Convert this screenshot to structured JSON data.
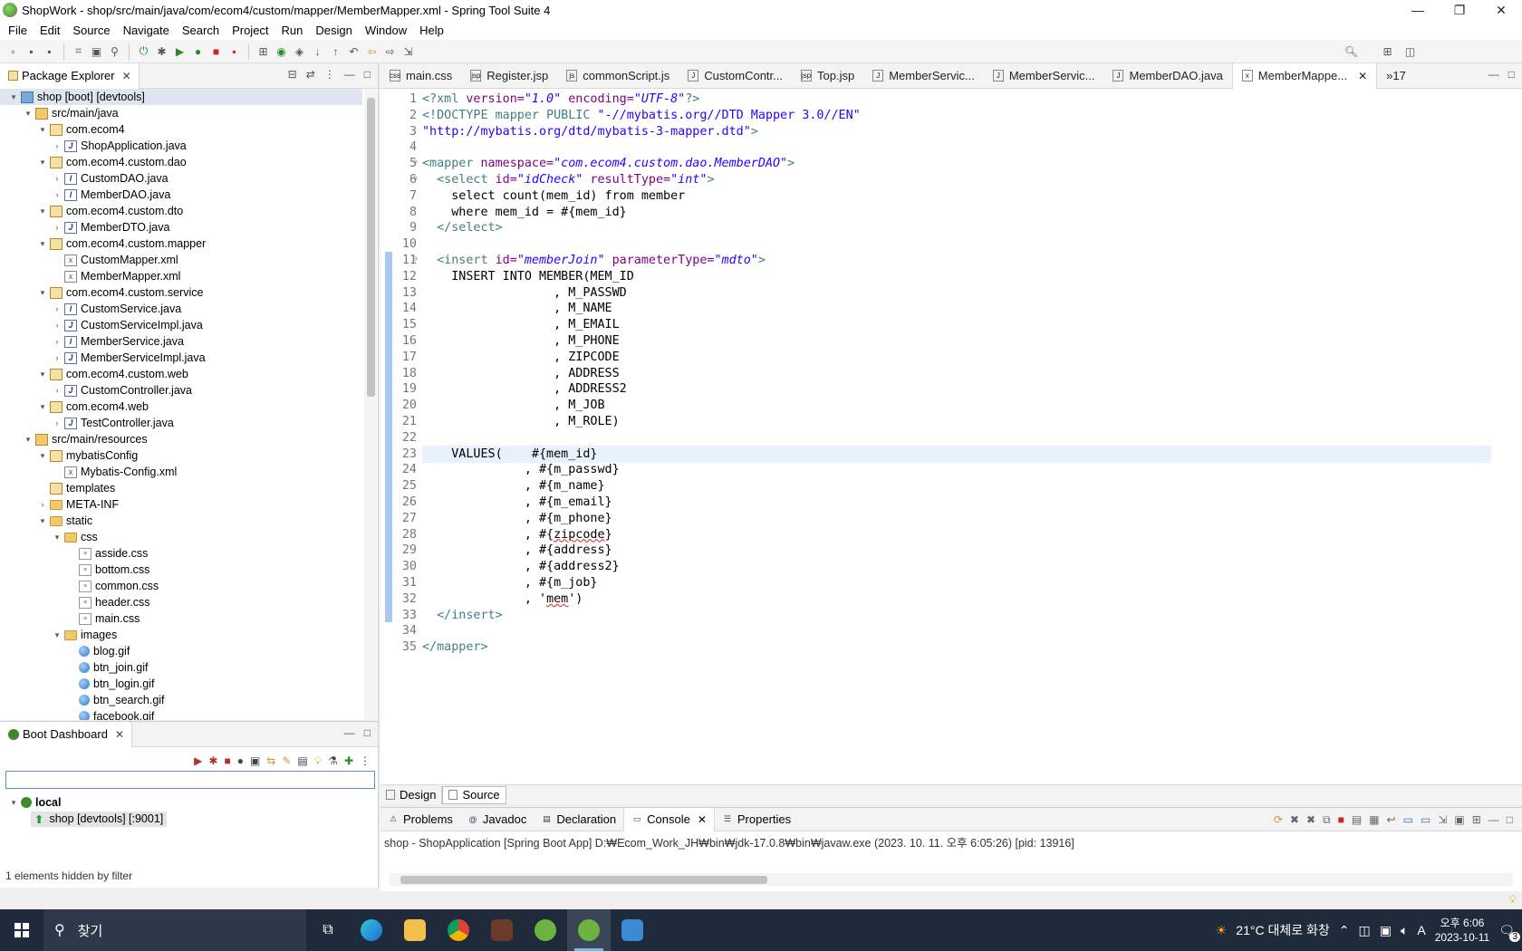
{
  "window": {
    "title": "ShopWork - shop/src/main/java/com/ecom4/custom/mapper/MemberMapper.xml - Spring Tool Suite 4",
    "controls": {
      "minimize": "—",
      "restore": "❐",
      "close": "✕"
    }
  },
  "menu": [
    "File",
    "Edit",
    "Source",
    "Navigate",
    "Search",
    "Project",
    "Run",
    "Design",
    "Window",
    "Help"
  ],
  "package_explorer": {
    "title": "Package Explorer",
    "tree": [
      {
        "label": "shop [boot] [devtools]",
        "depth": 0,
        "icon": "project-icon",
        "expander": "▾",
        "selected": true
      },
      {
        "label": "src/main/java",
        "depth": 1,
        "icon": "source-folder-icon",
        "expander": "▾"
      },
      {
        "label": "com.ecom4",
        "depth": 2,
        "icon": "package-icon",
        "expander": "▾"
      },
      {
        "label": "ShopApplication.java",
        "depth": 3,
        "icon": "java-file-icon",
        "expander": "›"
      },
      {
        "label": "com.ecom4.custom.dao",
        "depth": 2,
        "icon": "package-icon",
        "expander": "▾"
      },
      {
        "label": "CustomDAO.java",
        "depth": 3,
        "icon": "java-interface-icon",
        "expander": "›"
      },
      {
        "label": "MemberDAO.java",
        "depth": 3,
        "icon": "java-interface-icon",
        "expander": "›"
      },
      {
        "label": "com.ecom4.custom.dto",
        "depth": 2,
        "icon": "package-icon",
        "expander": "▾"
      },
      {
        "label": "MemberDTO.java",
        "depth": 3,
        "icon": "java-file-icon",
        "expander": "›"
      },
      {
        "label": "com.ecom4.custom.mapper",
        "depth": 2,
        "icon": "package-icon",
        "expander": "▾"
      },
      {
        "label": "CustomMapper.xml",
        "depth": 3,
        "icon": "xml-file-icon",
        "expander": ""
      },
      {
        "label": "MemberMapper.xml",
        "depth": 3,
        "icon": "xml-file-icon",
        "expander": ""
      },
      {
        "label": "com.ecom4.custom.service",
        "depth": 2,
        "icon": "package-icon",
        "expander": "▾"
      },
      {
        "label": "CustomService.java",
        "depth": 3,
        "icon": "java-interface-icon",
        "expander": "›"
      },
      {
        "label": "CustomServiceImpl.java",
        "depth": 3,
        "icon": "java-file-icon",
        "expander": "›"
      },
      {
        "label": "MemberService.java",
        "depth": 3,
        "icon": "java-interface-icon",
        "expander": "›"
      },
      {
        "label": "MemberServiceImpl.java",
        "depth": 3,
        "icon": "java-file-icon",
        "expander": "›"
      },
      {
        "label": "com.ecom4.custom.web",
        "depth": 2,
        "icon": "package-icon",
        "expander": "▾"
      },
      {
        "label": "CustomController.java",
        "depth": 3,
        "icon": "java-file-icon",
        "expander": "›"
      },
      {
        "label": "com.ecom4.web",
        "depth": 2,
        "icon": "package-icon",
        "expander": "▾"
      },
      {
        "label": "TestController.java",
        "depth": 3,
        "icon": "java-file-icon",
        "expander": "›"
      },
      {
        "label": "src/main/resources",
        "depth": 1,
        "icon": "source-folder-icon",
        "expander": "▾"
      },
      {
        "label": "mybatisConfig",
        "depth": 2,
        "icon": "package-icon",
        "expander": "▾"
      },
      {
        "label": "Mybatis-Config.xml",
        "depth": 3,
        "icon": "xml-file-icon",
        "expander": ""
      },
      {
        "label": "templates",
        "depth": 2,
        "icon": "package-icon",
        "expander": ""
      },
      {
        "label": "META-INF",
        "depth": 2,
        "icon": "folder-icon",
        "expander": "›"
      },
      {
        "label": "static",
        "depth": 2,
        "icon": "folder-icon",
        "expander": "▾"
      },
      {
        "label": "css",
        "depth": 3,
        "icon": "folder-icon",
        "expander": "▾"
      },
      {
        "label": "asside.css",
        "depth": 4,
        "icon": "css-file-icon",
        "expander": ""
      },
      {
        "label": "bottom.css",
        "depth": 4,
        "icon": "css-file-icon",
        "expander": ""
      },
      {
        "label": "common.css",
        "depth": 4,
        "icon": "css-file-icon",
        "expander": ""
      },
      {
        "label": "header.css",
        "depth": 4,
        "icon": "css-file-icon",
        "expander": ""
      },
      {
        "label": "main.css",
        "depth": 4,
        "icon": "css-file-icon",
        "expander": ""
      },
      {
        "label": "images",
        "depth": 3,
        "icon": "folder-icon",
        "expander": "▾"
      },
      {
        "label": "blog.gif",
        "depth": 4,
        "icon": "image-file-icon",
        "expander": ""
      },
      {
        "label": "btn_join.gif",
        "depth": 4,
        "icon": "image-file-icon",
        "expander": ""
      },
      {
        "label": "btn_login.gif",
        "depth": 4,
        "icon": "image-file-icon",
        "expander": ""
      },
      {
        "label": "btn_search.gif",
        "depth": 4,
        "icon": "image-file-icon",
        "expander": ""
      },
      {
        "label": "facebook.gif",
        "depth": 4,
        "icon": "image-file-icon",
        "expander": ""
      }
    ]
  },
  "boot_dashboard": {
    "title": "Boot Dashboard",
    "filter_value": "",
    "group": "local",
    "app": "shop [devtools] [:9001]",
    "status": "1 elements hidden by filter"
  },
  "editor": {
    "tabs": [
      {
        "label": "main.css",
        "icon": "css"
      },
      {
        "label": "Register.jsp",
        "icon": "jsp"
      },
      {
        "label": "commonScript.js",
        "icon": "js"
      },
      {
        "label": "CustomContr...",
        "icon": "J"
      },
      {
        "label": "Top.jsp",
        "icon": "jsp"
      },
      {
        "label": "MemberServic...",
        "icon": "J"
      },
      {
        "label": "MemberServic...",
        "icon": "J"
      },
      {
        "label": "MemberDAO.java",
        "icon": "J"
      },
      {
        "label": "MemberMappe...",
        "icon": "x",
        "active": true
      }
    ],
    "overflow": "»17",
    "current_line": 23,
    "changed_range": [
      11,
      33
    ],
    "lines": [
      [
        {
          "t": "<?xml ",
          "c": "t-pi"
        },
        {
          "t": "version=",
          "c": "t-attr"
        },
        {
          "t": "\"1.0\"",
          "c": "t-val"
        },
        {
          "t": " encoding=",
          "c": "t-attr"
        },
        {
          "t": "\"UTF-8\"",
          "c": "t-val"
        },
        {
          "t": "?>",
          "c": "t-pi"
        }
      ],
      [
        {
          "t": "<!DOCTYPE mapper PUBLIC ",
          "c": "t-doctype"
        },
        {
          "t": "\"-//mybatis.org//DTD Mapper 3.0//EN\"",
          "c": "t-str"
        }
      ],
      [
        {
          "t": "\"http://mybatis.org/dtd/mybatis-3-mapper.dtd\"",
          "c": "t-str"
        },
        {
          "t": ">",
          "c": "t-doctype"
        }
      ],
      [],
      [
        {
          "t": "<mapper ",
          "c": "t-tag"
        },
        {
          "t": "namespace=",
          "c": "t-attr"
        },
        {
          "t": "\"com.ecom4.custom.dao.MemberDAO\"",
          "c": "t-val"
        },
        {
          "t": ">",
          "c": "t-tag"
        }
      ],
      [
        {
          "t": "  <select ",
          "c": "t-tag"
        },
        {
          "t": "id=",
          "c": "t-attr"
        },
        {
          "t": "\"idCheck\"",
          "c": "t-val"
        },
        {
          "t": " resultType=",
          "c": "t-attr"
        },
        {
          "t": "\"int\"",
          "c": "t-val"
        },
        {
          "t": ">",
          "c": "t-tag"
        }
      ],
      [
        {
          "t": "    select count(mem_id) from member",
          "c": "t-text"
        }
      ],
      [
        {
          "t": "    where mem_id = #{mem_id}",
          "c": "t-text"
        }
      ],
      [
        {
          "t": "  </select>",
          "c": "t-tag"
        }
      ],
      [],
      [
        {
          "t": "  <insert ",
          "c": "t-tag"
        },
        {
          "t": "id=",
          "c": "t-attr"
        },
        {
          "t": "\"memberJoin\"",
          "c": "t-val"
        },
        {
          "t": " parameterType=",
          "c": "t-attr"
        },
        {
          "t": "\"mdto\"",
          "c": "t-val"
        },
        {
          "t": ">",
          "c": "t-tag"
        }
      ],
      [
        {
          "t": "    INSERT INTO MEMBER(MEM_ID",
          "c": "t-text"
        }
      ],
      [
        {
          "t": "                  , M_PASSWD",
          "c": "t-text"
        }
      ],
      [
        {
          "t": "                  , M_NAME",
          "c": "t-text"
        }
      ],
      [
        {
          "t": "                  , M_EMAIL",
          "c": "t-text"
        }
      ],
      [
        {
          "t": "                  , M_PHONE",
          "c": "t-text"
        }
      ],
      [
        {
          "t": "                  , ZIPCODE",
          "c": "t-text"
        }
      ],
      [
        {
          "t": "                  , ADDRESS",
          "c": "t-text"
        }
      ],
      [
        {
          "t": "                  , ADDRESS2",
          "c": "t-text"
        }
      ],
      [
        {
          "t": "                  , M_JOB",
          "c": "t-text"
        }
      ],
      [
        {
          "t": "                  , M_ROLE)",
          "c": "t-text"
        }
      ],
      [],
      [
        {
          "t": "    VALUES(    #{mem_id}",
          "c": "t-text"
        }
      ],
      [
        {
          "t": "              , #{m_passwd}",
          "c": "t-text"
        }
      ],
      [
        {
          "t": "              , #{m_name}",
          "c": "t-text"
        }
      ],
      [
        {
          "t": "              , #{m_email}",
          "c": "t-text"
        }
      ],
      [
        {
          "t": "              , #{m_phone}",
          "c": "t-text"
        }
      ],
      [
        {
          "t": "              , #{",
          "c": "t-text"
        },
        {
          "t": "zipcode",
          "c": "t-text squig"
        },
        {
          "t": "}",
          "c": "t-text"
        }
      ],
      [
        {
          "t": "              , #{address}",
          "c": "t-text"
        }
      ],
      [
        {
          "t": "              , #{address2}",
          "c": "t-text"
        }
      ],
      [
        {
          "t": "              , #{m_job}",
          "c": "t-text"
        }
      ],
      [
        {
          "t": "              , '",
          "c": "t-text"
        },
        {
          "t": "mem",
          "c": "t-text squig"
        },
        {
          "t": "')",
          "c": "t-text"
        }
      ],
      [
        {
          "t": "  </insert>",
          "c": "t-tag"
        }
      ],
      [],
      [
        {
          "t": "</mapper>",
          "c": "t-tag"
        }
      ]
    ],
    "fold_lines": [
      5,
      6,
      11
    ],
    "bottom_tabs": [
      {
        "label": "Design"
      },
      {
        "label": "Source",
        "active": true
      }
    ]
  },
  "console": {
    "tabs": [
      {
        "label": "Problems",
        "icon": "⚠"
      },
      {
        "label": "Javadoc",
        "icon": "@"
      },
      {
        "label": "Declaration",
        "icon": "▤"
      },
      {
        "label": "Console",
        "icon": "▭",
        "active": true,
        "closable": true
      },
      {
        "label": "Properties",
        "icon": "☰"
      }
    ],
    "text": "shop - ShopApplication [Spring Boot App] D:₩Ecom_Work_JH₩bin₩jdk-17.0.8₩bin₩javaw.exe  (2023. 10. 11. 오후 6:05:26) [pid: 13916]"
  },
  "taskbar": {
    "search_placeholder": "찾기",
    "weather": "21°C  대체로 화창",
    "time": "오후 6:06",
    "date": "2023-10-11",
    "notifications": "3",
    "ime": "A"
  }
}
